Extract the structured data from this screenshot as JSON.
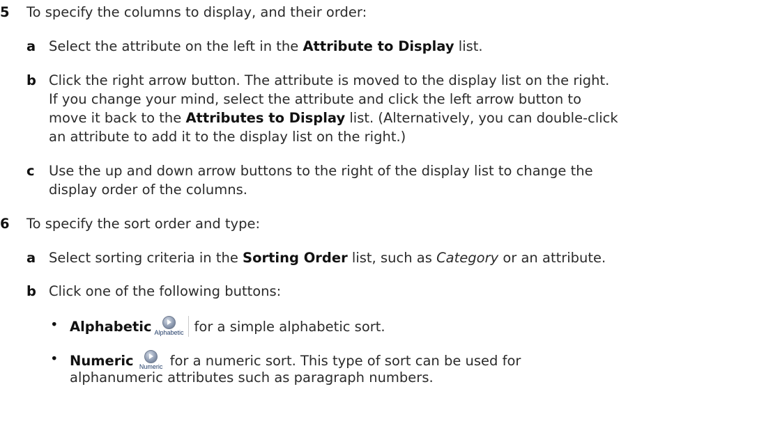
{
  "steps": [
    {
      "number": "5",
      "intro": "To specify the columns to display, and their order:",
      "substeps": [
        {
          "letter": "a",
          "pre": "Select the attribute on the left in the ",
          "bold": "Attribute to Display",
          "post": " list."
        },
        {
          "letter": "b",
          "line1": "Click the right arrow button. The attribute is moved to the display list on the right.",
          "line2": "If you change your mind, select the attribute and click the left arrow button to",
          "line3_pre": "move it back to the ",
          "line3_bold": "Attributes to Display",
          "line3_post": " list. (Alternatively, you can double-click",
          "line4": "an attribute to add it to the display list on the right.)"
        },
        {
          "letter": "c",
          "line1": "Use the up and down arrow buttons to the right of the display list to change the",
          "line2": "display order of the columns."
        }
      ]
    },
    {
      "number": "6",
      "intro": "To specify the sort order and type:",
      "substeps": [
        {
          "letter": "a",
          "pre": "Select sorting criteria in the ",
          "bold": "Sorting Order",
          "mid": " list, such as ",
          "italic": "Category",
          "post": " or an attribute."
        },
        {
          "letter": "b",
          "text": "Click one of the following buttons:",
          "bullets": [
            {
              "symbol": "•",
              "bold": "Alphabetic",
              "icon_name": "alphabetic-sort-icon",
              "icon_label": "Alphabetic",
              "text": "for a simple alphabetic sort."
            },
            {
              "symbol": "•",
              "bold": "Numeric",
              "icon_name": "numeric-sort-icon",
              "icon_label": "Numeric",
              "text": "for a numeric sort. This type of sort can be used for",
              "text_line2": "alphanumeric attributes such as paragraph numbers."
            }
          ]
        }
      ]
    }
  ]
}
